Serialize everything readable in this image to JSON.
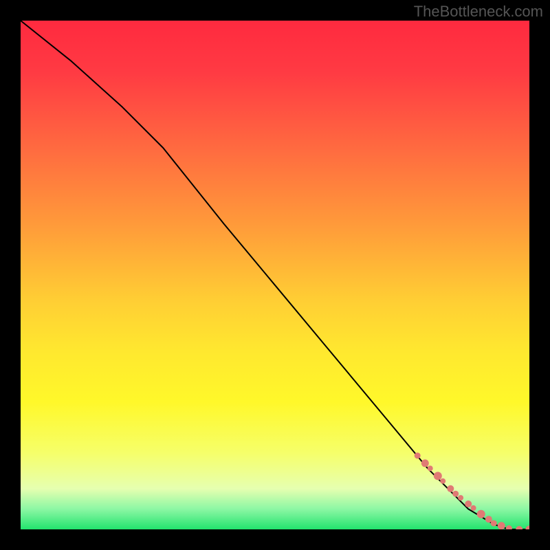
{
  "watermark": "TheBottleneck.com",
  "chart_data": {
    "type": "line",
    "title": "",
    "xlabel": "",
    "ylabel": "",
    "xlim": [
      0,
      100
    ],
    "ylim": [
      0,
      100
    ],
    "grid": false,
    "series": [
      {
        "name": "curve",
        "style": "line",
        "color": "#000000",
        "x": [
          0,
          10,
          20,
          28,
          40,
          50,
          60,
          70,
          80,
          88,
          93,
          96,
          100
        ],
        "y": [
          100,
          92,
          83,
          75,
          60,
          48,
          36,
          24,
          12,
          4,
          1,
          0,
          0
        ]
      },
      {
        "name": "markers",
        "style": "points",
        "color": "#e07a74",
        "sizes": [
          4.5,
          5.5,
          4,
          6,
          4,
          5,
          4.5,
          4,
          5,
          4,
          6,
          5,
          4.5,
          5.5,
          4.5,
          5,
          5.5
        ],
        "x": [
          78,
          79.5,
          80.5,
          82,
          83,
          84.5,
          85.5,
          86.5,
          88,
          89,
          90.5,
          92,
          93,
          94.5,
          96,
          98,
          100
        ],
        "y": [
          14.5,
          13,
          12,
          10.5,
          9.5,
          8,
          7,
          6.2,
          5,
          4.2,
          3,
          2,
          1.2,
          0.7,
          0.2,
          0,
          0
        ]
      }
    ]
  }
}
